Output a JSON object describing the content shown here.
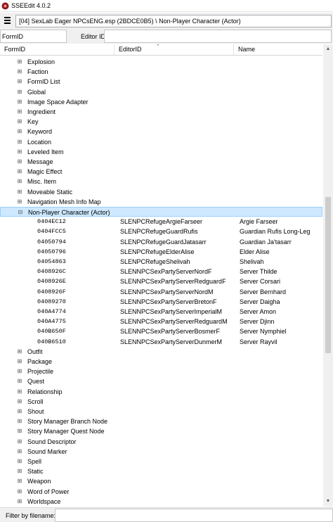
{
  "window": {
    "title": "SSEEdit 4.0.2",
    "accent": "#cde8ff",
    "icon": "sseedit-app-icon"
  },
  "toolbar": {
    "menu_icon": "hamburger-icon",
    "path": "[04] SexLab Eager NPCsENG.esp (2BDCE0B5) \\ Non-Player Character (Actor)"
  },
  "filters": {
    "formid_label": "FormID",
    "editorid_label": "Editor ID",
    "formid_value": "",
    "editorid_value": ""
  },
  "columns": {
    "formid": "FormID",
    "editorid": "EditorID",
    "name": "Name"
  },
  "tree": {
    "expand_icon": "⊞",
    "collapse_icon": "⊟",
    "rows": [
      {
        "kind": "group",
        "label": "Explosion"
      },
      {
        "kind": "group",
        "label": "Faction"
      },
      {
        "kind": "group",
        "label": "FormID List"
      },
      {
        "kind": "group",
        "label": "Global"
      },
      {
        "kind": "group",
        "label": "Image Space Adapter"
      },
      {
        "kind": "group",
        "label": "Ingredient"
      },
      {
        "kind": "group",
        "label": "Key"
      },
      {
        "kind": "group",
        "label": "Keyword"
      },
      {
        "kind": "group",
        "label": "Location"
      },
      {
        "kind": "group",
        "label": "Leveled Item"
      },
      {
        "kind": "group",
        "label": "Message"
      },
      {
        "kind": "group",
        "label": "Magic Effect"
      },
      {
        "kind": "group",
        "label": "Misc. Item"
      },
      {
        "kind": "group",
        "label": "Moveable Static"
      },
      {
        "kind": "group",
        "label": "Navigation Mesh Info Map"
      },
      {
        "kind": "group",
        "label": "Non-Player Character (Actor)",
        "expanded": true,
        "selected": true
      },
      {
        "kind": "record",
        "formid": "0404EC12",
        "editorid": "SLENPCRefugeArgieFarseer",
        "name": "Argie Farseer"
      },
      {
        "kind": "record",
        "formid": "0404FCC5",
        "editorid": "SLENPCRefugeGuardRufis",
        "name": "Guardian Rufis Long-Leg"
      },
      {
        "kind": "record",
        "formid": "04050794",
        "editorid": "SLENPCRefugeGuardJatasarr",
        "name": "Guardian Ja'tasarr"
      },
      {
        "kind": "record",
        "formid": "04050796",
        "editorid": "SLENPCRefugeElderAlise",
        "name": "Elder Alise"
      },
      {
        "kind": "record",
        "formid": "04054863",
        "editorid": "SLENPCRefugeShelivah",
        "name": "Shelivah"
      },
      {
        "kind": "record",
        "formid": "0408926C",
        "editorid": "SLENNPCSexPartyServerNordF",
        "name": "Server Thilde"
      },
      {
        "kind": "record",
        "formid": "0408926E",
        "editorid": "SLENNPCSexPartyServerRedguardF",
        "name": "Server Corsari"
      },
      {
        "kind": "record",
        "formid": "0408926F",
        "editorid": "SLENNPCSexPartyServerNordM",
        "name": "Server Bernhard"
      },
      {
        "kind": "record",
        "formid": "04089270",
        "editorid": "SLENNPCSexPartyServerBretonF",
        "name": "Server Daigha"
      },
      {
        "kind": "record",
        "formid": "040A4774",
        "editorid": "SLENNPCSexPartyServerImperialM",
        "name": "Server Amon"
      },
      {
        "kind": "record",
        "formid": "040A4775",
        "editorid": "SLENNPCSexPartyServerRedguardM",
        "name": "Server Djinn"
      },
      {
        "kind": "record",
        "formid": "040B650F",
        "editorid": "SLENNPCSexPartyServerBosmerF",
        "name": "Server Nymphiel"
      },
      {
        "kind": "record",
        "formid": "040B6510",
        "editorid": "SLENNPCSexPartyServerDunmerM",
        "name": "Server Rayvil"
      },
      {
        "kind": "group",
        "label": "Outfit"
      },
      {
        "kind": "group",
        "label": "Package"
      },
      {
        "kind": "group",
        "label": "Projectile"
      },
      {
        "kind": "group",
        "label": "Quest"
      },
      {
        "kind": "group",
        "label": "Relationship"
      },
      {
        "kind": "group",
        "label": "Scroll"
      },
      {
        "kind": "group",
        "label": "Shout"
      },
      {
        "kind": "group",
        "label": "Story Manager Branch Node"
      },
      {
        "kind": "group",
        "label": "Story Manager Quest Node"
      },
      {
        "kind": "group",
        "label": "Sound Descriptor"
      },
      {
        "kind": "group",
        "label": "Sound Marker"
      },
      {
        "kind": "group",
        "label": "Spell"
      },
      {
        "kind": "group",
        "label": "Static"
      },
      {
        "kind": "group",
        "label": "Weapon"
      },
      {
        "kind": "group",
        "label": "Word of Power"
      },
      {
        "kind": "group",
        "label": "Worldspace"
      }
    ]
  },
  "scrollbar": {
    "up_icon": "▲",
    "down_icon": "▼",
    "position": 0.42
  },
  "footer": {
    "filter_label": "Filter by filename:",
    "filter_value": ""
  }
}
